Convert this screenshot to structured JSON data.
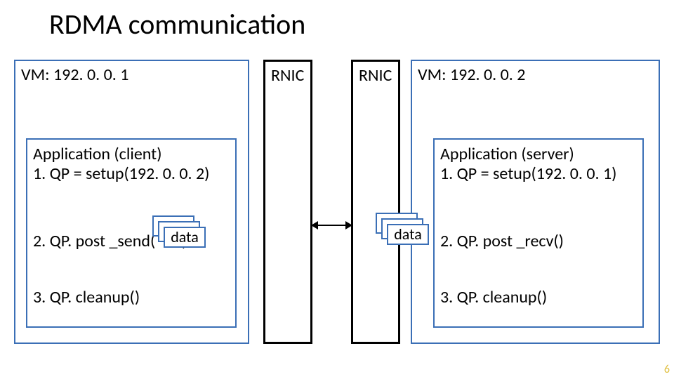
{
  "title": "RDMA communication",
  "vm_left": {
    "header": "VM: 192. 0. 0. 1",
    "app_header": "Application (client)",
    "step1": "1. QP = setup(192. 0. 0. 2)",
    "step2": "2. QP. post _send(       )",
    "step3": "3. QP. cleanup()",
    "data_label": "data"
  },
  "vm_right": {
    "header": "VM: 192. 0. 0. 2",
    "app_header": "Application (server)",
    "step1": "1. QP = setup(192. 0. 0. 1)",
    "step2": "2. QP. post _recv()",
    "step3": "3. QP. cleanup()",
    "data_label": "data"
  },
  "rnic_left": "RNIC",
  "rnic_right": "RNIC",
  "page_number": "6"
}
